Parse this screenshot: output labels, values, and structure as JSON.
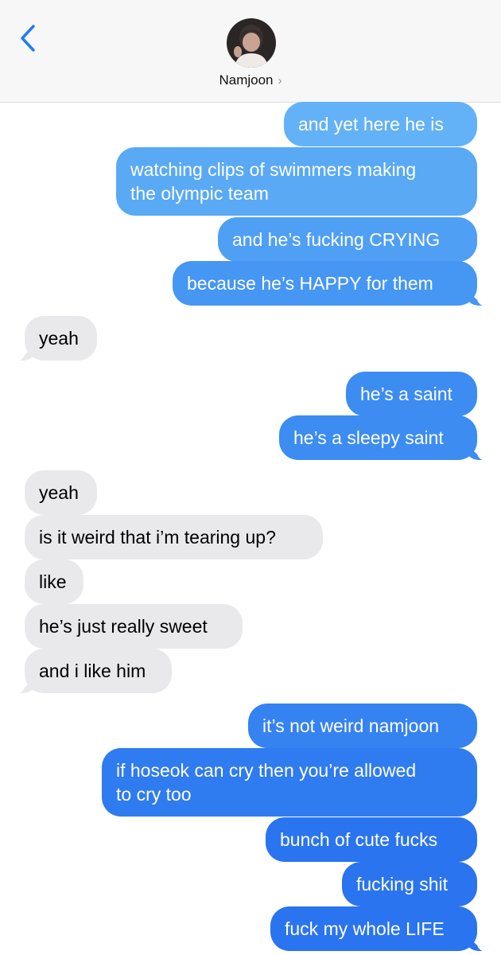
{
  "header": {
    "contact_name": "Namjoon",
    "back_icon": "chevron-left-icon",
    "disclosure_icon": "chevron-right-icon",
    "back_color": "#1f7cf0"
  },
  "messages": [
    {
      "sender": "me",
      "text": "and yet here he is"
    },
    {
      "sender": "me",
      "text": "watching clips of swimmers making the olympic team",
      "lines": [
        "watching clips of swimmers making",
        "the olympic team"
      ]
    },
    {
      "sender": "me",
      "text": "and he’s fucking CRYING"
    },
    {
      "sender": "me",
      "text": "because he’s HAPPY for them"
    },
    {
      "sender": "them",
      "text": "yeah"
    },
    {
      "sender": "me",
      "text": "he’s a saint"
    },
    {
      "sender": "me",
      "text": "he’s a sleepy saint"
    },
    {
      "sender": "them",
      "text": "yeah"
    },
    {
      "sender": "them",
      "text": "is it weird that i’m tearing up?"
    },
    {
      "sender": "them",
      "text": "like"
    },
    {
      "sender": "them",
      "text": "he’s just really sweet"
    },
    {
      "sender": "them",
      "text": "and i like him"
    },
    {
      "sender": "me",
      "text": "it’s not weird namjoon"
    },
    {
      "sender": "me",
      "text": "if hoseok can cry then you’re allowed to cry too",
      "lines": [
        "if hoseok can cry then you’re allowed",
        "to cry too"
      ]
    },
    {
      "sender": "me",
      "text": "bunch of cute fucks"
    },
    {
      "sender": "me",
      "text": "fucking shit"
    },
    {
      "sender": "me",
      "text": "fuck my whole LIFE"
    }
  ]
}
